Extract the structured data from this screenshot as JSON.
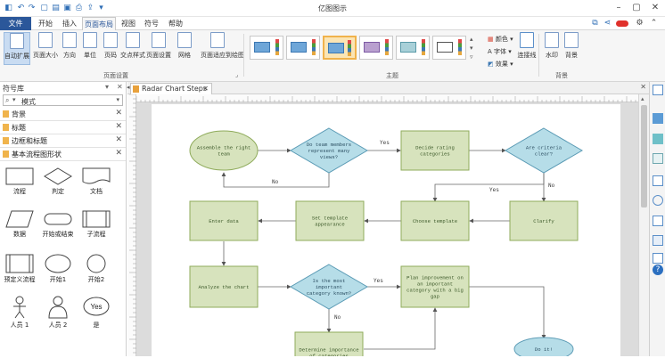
{
  "app": {
    "title": "亿图图示",
    "quick_access": [
      "save-icon",
      "undo-icon",
      "redo-icon",
      "new-icon",
      "open-icon",
      "print-icon",
      "export-icon",
      "customize-icon"
    ]
  },
  "menu": {
    "file": "文件",
    "tabs": [
      "开始",
      "插入",
      "页面布局",
      "视图",
      "符号",
      "帮助"
    ],
    "active": "页面布局"
  },
  "ribbon": {
    "page_setup": {
      "buttons": [
        "自动扩展",
        "页面大小",
        "方向",
        "单位",
        "页码",
        "交点样式",
        "页面设置",
        "网格",
        "页面适应到绘图"
      ],
      "group_label": "页面设置"
    },
    "theme": {
      "group_label": "主题",
      "selected_index": 3,
      "count": 6,
      "options": [
        "颜色",
        "字体",
        "效果"
      ]
    },
    "connector": {
      "label": "连接线"
    },
    "background": {
      "buttons": [
        "水印",
        "背景"
      ],
      "group_label": "背景"
    }
  },
  "library": {
    "title": "符号库",
    "search_placeholder": "模式",
    "categories": [
      "背景",
      "标题",
      "边框和标题",
      "基本流程图形状"
    ],
    "shapes": [
      "流程",
      "判定",
      "文档",
      "数据",
      "开始或结束",
      "子流程",
      "预定义流程",
      "开始1",
      "开始2",
      "人员 1",
      "人员 2",
      "是"
    ],
    "yes_glyph": "Yes"
  },
  "document": {
    "tab_title": "Radar Chart Steps"
  },
  "diagram": {
    "nodes": {
      "assemble": "Assemble the right team",
      "do_team": "Do team members represent many views?",
      "decide": "Decide rating categories",
      "criteria": "Are criteria clear?",
      "enter": "Enter data",
      "template": "Set template appearance",
      "choose": "Choose template",
      "clarify": "Clarify",
      "analyze": "Analyze the chart",
      "most": "Is the most important category known?",
      "plan": "Plan improvement on an important category with a big gap",
      "determine": "Determine importance of categories",
      "doit": "Do it!"
    },
    "labels": {
      "yes1": "Yes",
      "no1": "No",
      "yes2": "Yes",
      "no2": "No",
      "yes3": "Yes",
      "no3": "No"
    }
  },
  "colors": {
    "process_fill": "#d7e3bd",
    "process_stroke": "#8fab5b",
    "decision_fill": "#b6dde8",
    "decision_stroke": "#5b9bb5",
    "accent": "#2b579a"
  }
}
